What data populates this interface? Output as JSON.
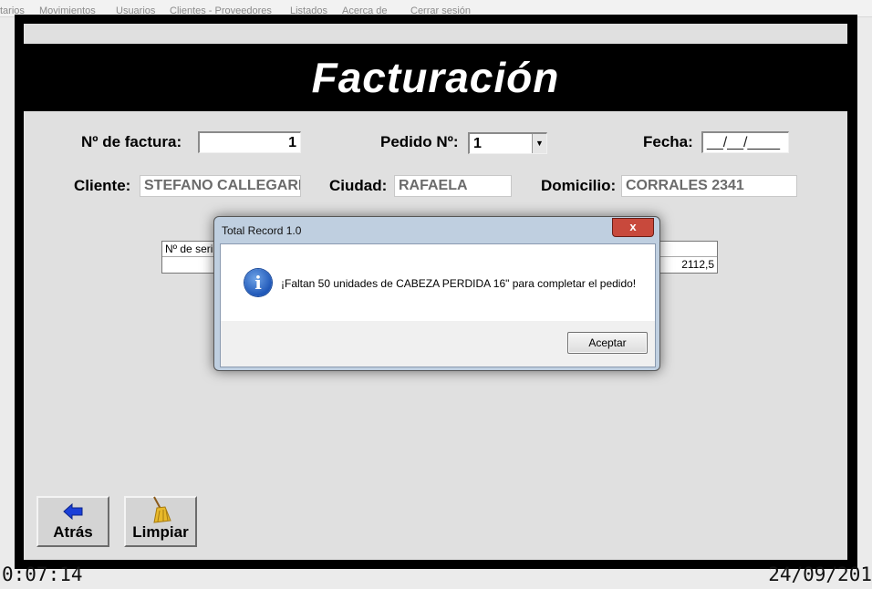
{
  "menu": [
    "tarios",
    "Movimientos",
    "Usuarios",
    "Clientes - Proveedores",
    "Listados",
    "Acerca de",
    "Cerrar sesión"
  ],
  "form": {
    "title": "Facturación",
    "factura_label": "Nº de factura:",
    "factura_value": "1",
    "pedido_label": "Pedido Nº:",
    "pedido_value": "1",
    "fecha_label": "Fecha:",
    "fecha_value": "__/__/____",
    "cliente_label": "Cliente:",
    "cliente_value": "STEFANO CALLEGARI",
    "ciudad_label": "Ciudad:",
    "ciudad_value": "RAFAELA",
    "domicilio_label": "Domicilio:",
    "domicilio_value": "CORRALES 2341"
  },
  "table": {
    "header_first": "Nº de seri",
    "cell_value": "2112,5"
  },
  "buttons": {
    "back": "Atrás",
    "clear": "Limpiar"
  },
  "status": {
    "clock": "0:07:14",
    "date": "24/09/201"
  },
  "dialog": {
    "title": "Total Record 1.0",
    "close": "x",
    "message": "¡Faltan 50 unidades de CABEZA PERDIDA 16\" para completar el pedido!",
    "ok": "Aceptar",
    "icon": "i"
  },
  "colors": {
    "frame": "#000000",
    "form_bg": "#e0e0e0",
    "close_button": "#c8493c",
    "info_icon": "#1f57b8"
  }
}
